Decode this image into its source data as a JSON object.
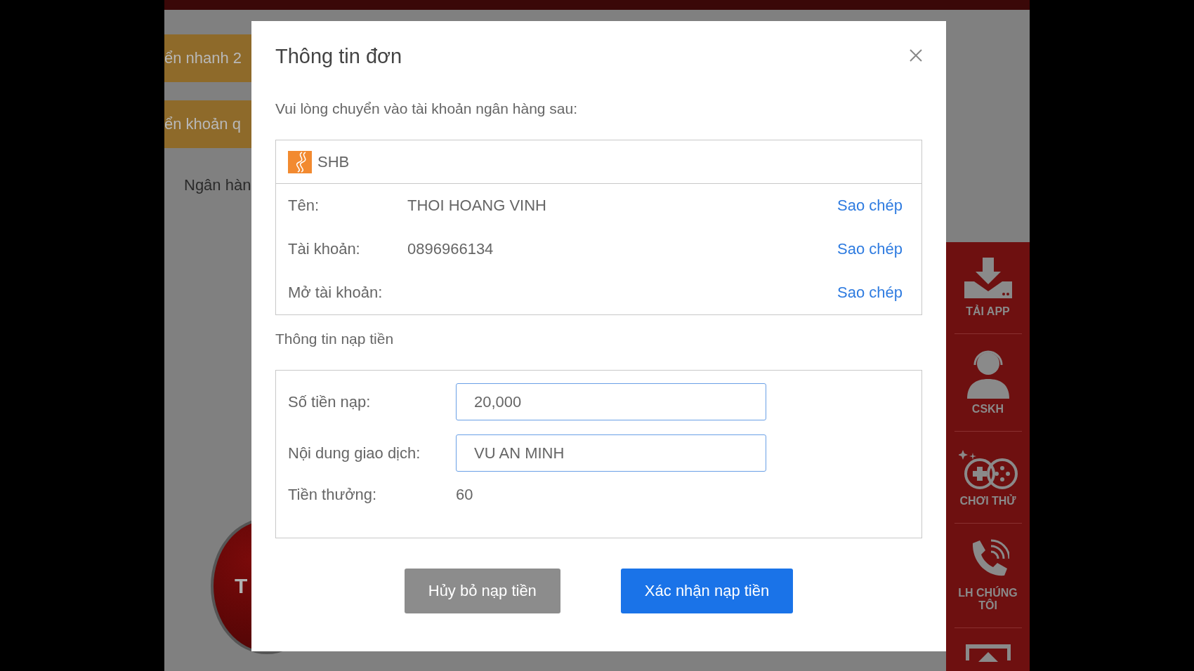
{
  "background": {
    "tabs": [
      {
        "label": "ển nhanh 2"
      },
      {
        "label": "ển khoản q"
      }
    ],
    "bank_label": "Ngân hàn",
    "round_button": "T"
  },
  "sidebar": {
    "items": [
      {
        "kind": "download",
        "label": "TẢI APP"
      },
      {
        "kind": "support",
        "label": "CSKH"
      },
      {
        "kind": "game",
        "label": "CHƠI THỬ"
      },
      {
        "kind": "phone",
        "label": "LH CHÚNG TÔI"
      },
      {
        "kind": "top"
      }
    ]
  },
  "dialog": {
    "title": "Thông tin đơn",
    "instruction": "Vui lòng chuyển vào tài khoản ngân hàng sau:",
    "bank": {
      "name": "SHB",
      "rows": [
        {
          "label": "Tên:",
          "value": "THOI HOANG VINH",
          "action": "Sao chép"
        },
        {
          "label": "Tài khoản:",
          "value": "0896966134",
          "action": "Sao chép"
        },
        {
          "label": "Mở tài khoản:",
          "action": "Sao chép"
        }
      ]
    },
    "section_title": "Thông tin nạp tiền",
    "fields": [
      {
        "kind": "input",
        "label": "Số tiền nạp:",
        "value": "20,000"
      },
      {
        "kind": "input",
        "label": "Nội dung giao dịch:",
        "value": "VU AN MINH"
      },
      {
        "kind": "text",
        "label": "Tiền thưởng:",
        "value": "60"
      }
    ],
    "buttons": [
      {
        "kind": "secondary",
        "label": "Hủy bỏ nạp tiền"
      },
      {
        "kind": "primary",
        "label": "Xác nhận nạp tiền"
      }
    ]
  }
}
